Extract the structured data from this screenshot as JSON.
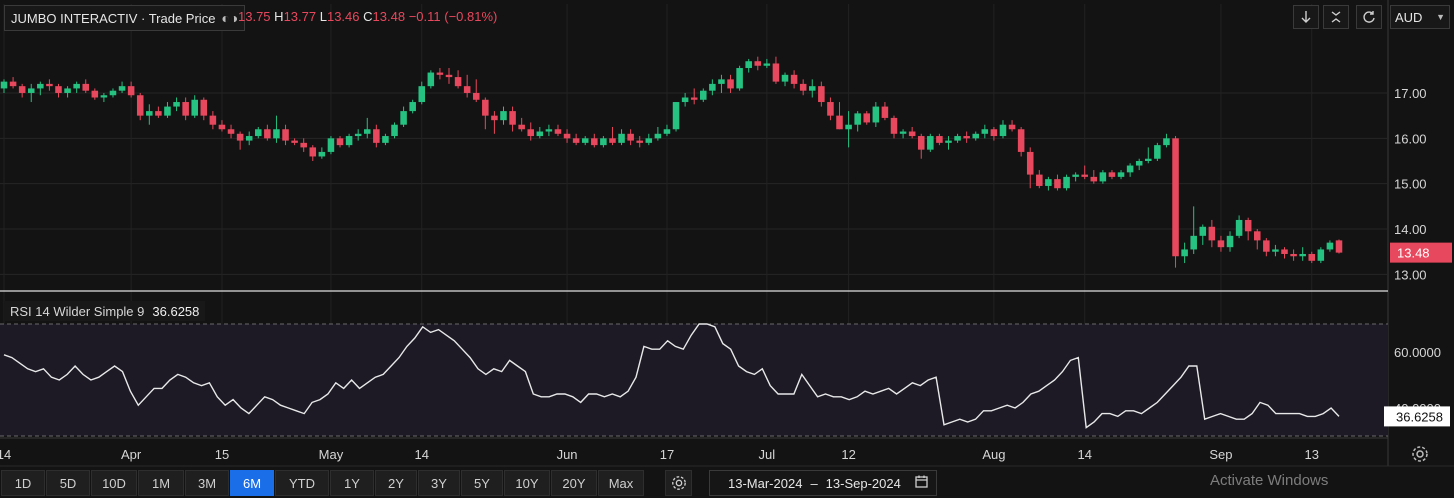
{
  "header": {
    "title": "JUMBO INTERACTIV · Trade Price",
    "ohlc_prefix": "O",
    "open_value": "13.75",
    "high_label": "H",
    "high_value": "13.77",
    "low_label": "L",
    "low_value": "13.46",
    "close_label": "C",
    "close_value": "13.48",
    "change": "−0.11 (−0.81%)",
    "currency": "AUD"
  },
  "colors": {
    "up": "#26c281",
    "down": "#e8485d",
    "accent": "#1a6ee8",
    "background": "#131313"
  },
  "toolbar_icons": [
    "arrow-down-icon",
    "collapse-icon",
    "refresh-icon"
  ],
  "rsi": {
    "label": "RSI 14 Wilder Simple 9",
    "value": "36.6258",
    "tag": "36.6258",
    "axis_ticks": [
      {
        "value": 60,
        "label": "60.0000"
      },
      {
        "value": 40,
        "label": "40.0000"
      }
    ]
  },
  "range_buttons": [
    "1D",
    "5D",
    "10D",
    "1M",
    "3M",
    "6M",
    "YTD",
    "1Y",
    "2Y",
    "3Y",
    "5Y",
    "10Y",
    "20Y",
    "Max"
  ],
  "active_range": "6M",
  "date_range": {
    "from": "13-Mar-2024",
    "separator": "–",
    "to": "13-Sep-2024"
  },
  "watermark": "Activate Windows",
  "chart_data": {
    "type": "candlestick",
    "y_ticks": [
      13,
      14,
      15,
      16,
      17
    ],
    "y_tick_labels": [
      "13.00",
      "14.00",
      "15.00",
      "16.00",
      "17.00"
    ],
    "ylim": [
      12.7,
      18.3
    ],
    "last_price_tag": "13.48",
    "x_tick_labels": [
      {
        "label": "14",
        "bar": 0
      },
      {
        "label": "Apr",
        "bar": 14
      },
      {
        "label": "15",
        "bar": 24
      },
      {
        "label": "May",
        "bar": 36
      },
      {
        "label": "14",
        "bar": 46
      },
      {
        "label": "Jun",
        "bar": 62
      },
      {
        "label": "17",
        "bar": 73
      },
      {
        "label": "Jul",
        "bar": 84
      },
      {
        "label": "12",
        "bar": 93
      },
      {
        "label": "Aug",
        "bar": 109
      },
      {
        "label": "14",
        "bar": 119
      },
      {
        "label": "Sep",
        "bar": 134
      },
      {
        "label": "13",
        "bar": 144
      }
    ],
    "candles": [
      [
        17.1,
        17.3,
        17.0,
        17.25
      ],
      [
        17.25,
        17.35,
        17.1,
        17.15
      ],
      [
        17.15,
        17.2,
        16.9,
        17.0
      ],
      [
        17.0,
        17.2,
        16.8,
        17.1
      ],
      [
        17.1,
        17.25,
        16.95,
        17.2
      ],
      [
        17.2,
        17.3,
        17.05,
        17.15
      ],
      [
        17.15,
        17.2,
        16.9,
        17.0
      ],
      [
        17.0,
        17.15,
        16.9,
        17.1
      ],
      [
        17.1,
        17.25,
        17.0,
        17.2
      ],
      [
        17.2,
        17.3,
        17.0,
        17.05
      ],
      [
        17.05,
        17.1,
        16.85,
        16.9
      ],
      [
        16.9,
        17.0,
        16.8,
        16.95
      ],
      [
        16.95,
        17.1,
        16.9,
        17.05
      ],
      [
        17.05,
        17.25,
        17.0,
        17.15
      ],
      [
        17.15,
        17.25,
        16.9,
        16.95
      ],
      [
        16.95,
        17.0,
        16.4,
        16.5
      ],
      [
        16.5,
        16.75,
        16.3,
        16.6
      ],
      [
        16.6,
        16.7,
        16.45,
        16.5
      ],
      [
        16.5,
        16.8,
        16.45,
        16.7
      ],
      [
        16.7,
        16.9,
        16.6,
        16.8
      ],
      [
        16.8,
        16.9,
        16.4,
        16.5
      ],
      [
        16.5,
        16.95,
        16.45,
        16.85
      ],
      [
        16.85,
        16.9,
        16.4,
        16.5
      ],
      [
        16.5,
        16.6,
        16.2,
        16.3
      ],
      [
        16.3,
        16.4,
        16.15,
        16.2
      ],
      [
        16.2,
        16.3,
        16.0,
        16.1
      ],
      [
        16.1,
        16.15,
        15.75,
        15.95
      ],
      [
        15.95,
        16.15,
        15.85,
        16.05
      ],
      [
        16.05,
        16.25,
        16.0,
        16.2
      ],
      [
        16.2,
        16.3,
        15.95,
        16.0
      ],
      [
        16.0,
        16.5,
        15.9,
        16.2
      ],
      [
        16.2,
        16.3,
        15.85,
        15.95
      ],
      [
        15.95,
        16.0,
        15.85,
        15.9
      ],
      [
        15.9,
        16.0,
        15.7,
        15.8
      ],
      [
        15.8,
        15.85,
        15.5,
        15.6
      ],
      [
        15.6,
        15.8,
        15.55,
        15.7
      ],
      [
        15.7,
        16.05,
        15.65,
        16.0
      ],
      [
        16.0,
        16.05,
        15.8,
        15.85
      ],
      [
        15.85,
        16.1,
        15.8,
        16.05
      ],
      [
        16.05,
        16.2,
        15.95,
        16.1
      ],
      [
        16.1,
        16.45,
        16.0,
        16.2
      ],
      [
        16.2,
        16.3,
        15.8,
        15.9
      ],
      [
        15.9,
        16.1,
        15.85,
        16.05
      ],
      [
        16.05,
        16.35,
        16.0,
        16.3
      ],
      [
        16.3,
        16.7,
        16.25,
        16.6
      ],
      [
        16.6,
        16.85,
        16.55,
        16.8
      ],
      [
        16.8,
        17.25,
        16.75,
        17.15
      ],
      [
        17.15,
        17.5,
        17.1,
        17.45
      ],
      [
        17.45,
        17.55,
        17.3,
        17.4
      ],
      [
        17.4,
        17.55,
        17.2,
        17.35
      ],
      [
        17.35,
        17.5,
        17.1,
        17.15
      ],
      [
        17.15,
        17.4,
        16.9,
        17.0
      ],
      [
        17.0,
        17.3,
        16.8,
        16.85
      ],
      [
        16.85,
        16.9,
        16.2,
        16.5
      ],
      [
        16.5,
        16.6,
        16.1,
        16.4
      ],
      [
        16.4,
        16.7,
        16.3,
        16.6
      ],
      [
        16.6,
        16.7,
        16.15,
        16.3
      ],
      [
        16.3,
        16.45,
        16.15,
        16.2
      ],
      [
        16.2,
        16.35,
        15.95,
        16.05
      ],
      [
        16.05,
        16.25,
        16.0,
        16.15
      ],
      [
        16.15,
        16.3,
        16.05,
        16.2
      ],
      [
        16.2,
        16.3,
        16.05,
        16.1
      ],
      [
        16.1,
        16.2,
        15.9,
        16.0
      ],
      [
        16.0,
        16.1,
        15.85,
        15.9
      ],
      [
        15.9,
        16.05,
        15.85,
        16.0
      ],
      [
        16.0,
        16.1,
        15.8,
        15.85
      ],
      [
        15.85,
        16.05,
        15.8,
        16.0
      ],
      [
        16.0,
        16.25,
        15.85,
        15.9
      ],
      [
        15.9,
        16.2,
        15.85,
        16.1
      ],
      [
        16.1,
        16.2,
        15.85,
        15.95
      ],
      [
        15.95,
        16.05,
        15.8,
        15.9
      ],
      [
        15.9,
        16.1,
        15.85,
        16.0
      ],
      [
        16.0,
        16.25,
        15.95,
        16.1
      ],
      [
        16.1,
        16.3,
        16.05,
        16.2
      ],
      [
        16.2,
        16.8,
        16.15,
        16.8
      ],
      [
        16.8,
        17.0,
        16.7,
        16.9
      ],
      [
        16.9,
        17.1,
        16.75,
        16.85
      ],
      [
        16.85,
        17.1,
        16.8,
        17.05
      ],
      [
        17.05,
        17.3,
        16.95,
        17.2
      ],
      [
        17.2,
        17.4,
        17.0,
        17.3
      ],
      [
        17.3,
        17.4,
        17.0,
        17.1
      ],
      [
        17.1,
        17.6,
        17.05,
        17.55
      ],
      [
        17.55,
        17.75,
        17.45,
        17.7
      ],
      [
        17.7,
        17.8,
        17.5,
        17.6
      ],
      [
        17.6,
        17.75,
        17.55,
        17.65
      ],
      [
        17.65,
        17.8,
        17.2,
        17.25
      ],
      [
        17.25,
        17.45,
        17.15,
        17.4
      ],
      [
        17.4,
        17.5,
        17.1,
        17.2
      ],
      [
        17.2,
        17.3,
        16.95,
        17.05
      ],
      [
        17.05,
        17.3,
        16.9,
        17.15
      ],
      [
        17.15,
        17.25,
        16.7,
        16.8
      ],
      [
        16.8,
        16.9,
        16.4,
        16.5
      ],
      [
        16.5,
        16.8,
        16.2,
        16.2
      ],
      [
        16.2,
        16.6,
        15.8,
        16.3
      ],
      [
        16.3,
        16.6,
        16.15,
        16.55
      ],
      [
        16.55,
        16.6,
        16.3,
        16.35
      ],
      [
        16.35,
        16.8,
        16.25,
        16.7
      ],
      [
        16.7,
        16.8,
        16.4,
        16.45
      ],
      [
        16.45,
        16.5,
        16.0,
        16.1
      ],
      [
        16.1,
        16.2,
        16.0,
        16.15
      ],
      [
        16.15,
        16.25,
        16.0,
        16.05
      ],
      [
        16.05,
        16.1,
        15.55,
        15.75
      ],
      [
        15.75,
        16.1,
        15.7,
        16.05
      ],
      [
        16.05,
        16.1,
        15.85,
        15.9
      ],
      [
        15.9,
        16.05,
        15.75,
        15.95
      ],
      [
        15.95,
        16.1,
        15.9,
        16.05
      ],
      [
        16.05,
        16.15,
        15.9,
        16.0
      ],
      [
        16.0,
        16.15,
        15.95,
        16.1
      ],
      [
        16.1,
        16.3,
        16.0,
        16.2
      ],
      [
        16.2,
        16.25,
        15.95,
        16.05
      ],
      [
        16.05,
        16.4,
        16.0,
        16.3
      ],
      [
        16.3,
        16.4,
        16.15,
        16.2
      ],
      [
        16.2,
        16.25,
        15.6,
        15.7
      ],
      [
        15.7,
        15.8,
        14.9,
        15.2
      ],
      [
        15.2,
        15.3,
        14.9,
        14.95
      ],
      [
        14.95,
        15.15,
        14.85,
        15.1
      ],
      [
        15.1,
        15.2,
        14.85,
        14.9
      ],
      [
        14.9,
        15.2,
        14.85,
        15.15
      ],
      [
        15.15,
        15.25,
        15.05,
        15.2
      ],
      [
        15.2,
        15.4,
        15.1,
        15.15
      ],
      [
        15.15,
        15.3,
        15.0,
        15.05
      ],
      [
        15.05,
        15.3,
        15.0,
        15.25
      ],
      [
        15.25,
        15.3,
        15.1,
        15.15
      ],
      [
        15.15,
        15.3,
        15.1,
        15.25
      ],
      [
        15.25,
        15.45,
        15.15,
        15.4
      ],
      [
        15.4,
        15.55,
        15.3,
        15.5
      ],
      [
        15.5,
        15.8,
        15.45,
        15.55
      ],
      [
        15.55,
        15.9,
        15.5,
        15.85
      ],
      [
        15.85,
        16.1,
        15.8,
        16.0
      ],
      [
        16.0,
        16.05,
        13.15,
        13.4
      ],
      [
        13.4,
        13.7,
        13.25,
        13.55
      ],
      [
        13.55,
        14.5,
        13.45,
        13.85
      ],
      [
        13.85,
        14.1,
        13.65,
        14.05
      ],
      [
        14.05,
        14.2,
        13.6,
        13.75
      ],
      [
        13.75,
        13.85,
        13.5,
        13.6
      ],
      [
        13.6,
        13.95,
        13.5,
        13.85
      ],
      [
        13.85,
        14.3,
        13.8,
        14.2
      ],
      [
        14.2,
        14.25,
        13.75,
        13.95
      ],
      [
        13.95,
        14.0,
        13.55,
        13.75
      ],
      [
        13.75,
        13.8,
        13.4,
        13.5
      ],
      [
        13.5,
        13.65,
        13.4,
        13.55
      ],
      [
        13.55,
        13.6,
        13.35,
        13.45
      ],
      [
        13.45,
        13.55,
        13.3,
        13.4
      ],
      [
        13.4,
        13.6,
        13.3,
        13.45
      ],
      [
        13.45,
        13.5,
        13.25,
        13.3
      ],
      [
        13.3,
        13.6,
        13.25,
        13.55
      ],
      [
        13.55,
        13.75,
        13.5,
        13.7
      ],
      [
        13.75,
        13.77,
        13.46,
        13.48
      ]
    ],
    "rsi_ylim": [
      30,
      80
    ],
    "rsi_values": [
      59,
      58,
      56,
      54,
      53,
      54,
      51,
      50,
      52,
      55,
      52,
      50,
      51,
      53,
      55,
      53,
      46,
      41,
      44,
      47,
      47,
      50,
      52,
      51,
      49,
      48,
      49,
      44,
      41,
      43,
      40,
      38,
      41,
      44,
      43,
      41,
      40,
      39,
      38,
      42,
      43,
      45,
      49,
      47,
      50,
      47,
      49,
      51,
      52,
      55,
      58,
      62,
      65,
      69,
      67,
      68,
      66,
      64,
      61,
      58,
      54,
      52,
      54,
      53,
      57,
      55,
      53,
      45,
      44,
      44,
      45,
      45,
      44,
      42,
      45,
      45,
      44,
      45,
      44,
      46,
      51,
      62,
      61,
      61,
      64,
      62,
      61,
      66,
      70,
      70,
      69,
      63,
      61,
      55,
      53,
      52,
      54,
      48,
      45,
      45,
      45,
      52,
      48,
      44,
      45,
      44,
      44,
      43,
      44,
      46,
      45,
      46,
      47,
      45,
      47,
      49,
      48,
      50,
      51,
      34,
      35,
      36,
      35,
      36,
      39,
      39,
      40,
      41,
      40,
      42,
      45,
      46,
      48,
      50,
      53,
      57,
      58,
      33,
      35,
      38,
      38,
      37,
      39,
      39,
      38,
      40,
      42,
      45,
      48,
      51,
      55,
      55,
      36,
      37,
      38,
      37,
      36,
      36,
      38,
      42,
      41,
      38,
      38,
      38,
      38,
      37,
      37,
      38,
      40,
      37
    ]
  }
}
